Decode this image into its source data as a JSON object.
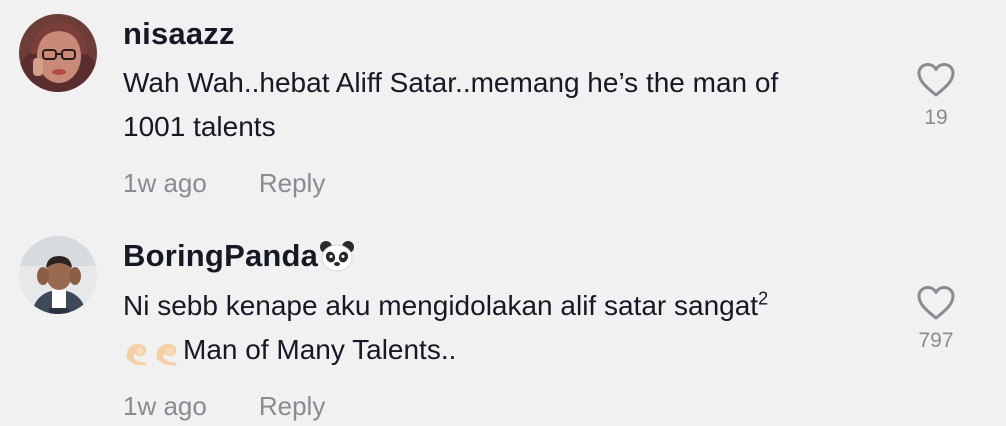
{
  "comments": [
    {
      "username": "nisaazz",
      "text_line1": "Wah Wah..hebat Aliff Satar..memang he’s the man of",
      "text_line2": "1001 talents",
      "time": "1w ago",
      "reply": "Reply",
      "likes": "19",
      "avatar_icon": "avatar-hijab-glasses"
    },
    {
      "username": "BoringPanda",
      "username_emoji": "panda-face-icon",
      "text_line1": "Ni sebb kenape aku mengidolakan alif satar sangat",
      "text_line1_sup": "2",
      "text_line2_emoji": "pinched-fingers-icon x2",
      "text_line2": "Man of Many Talents..",
      "time": "1w ago",
      "reply": "Reply",
      "likes": "797",
      "avatar_icon": "avatar-man-covering-ears"
    }
  ],
  "colors": {
    "background": "#f1f1f2",
    "primary_text": "#161823",
    "secondary_text": "#8a8b91"
  }
}
